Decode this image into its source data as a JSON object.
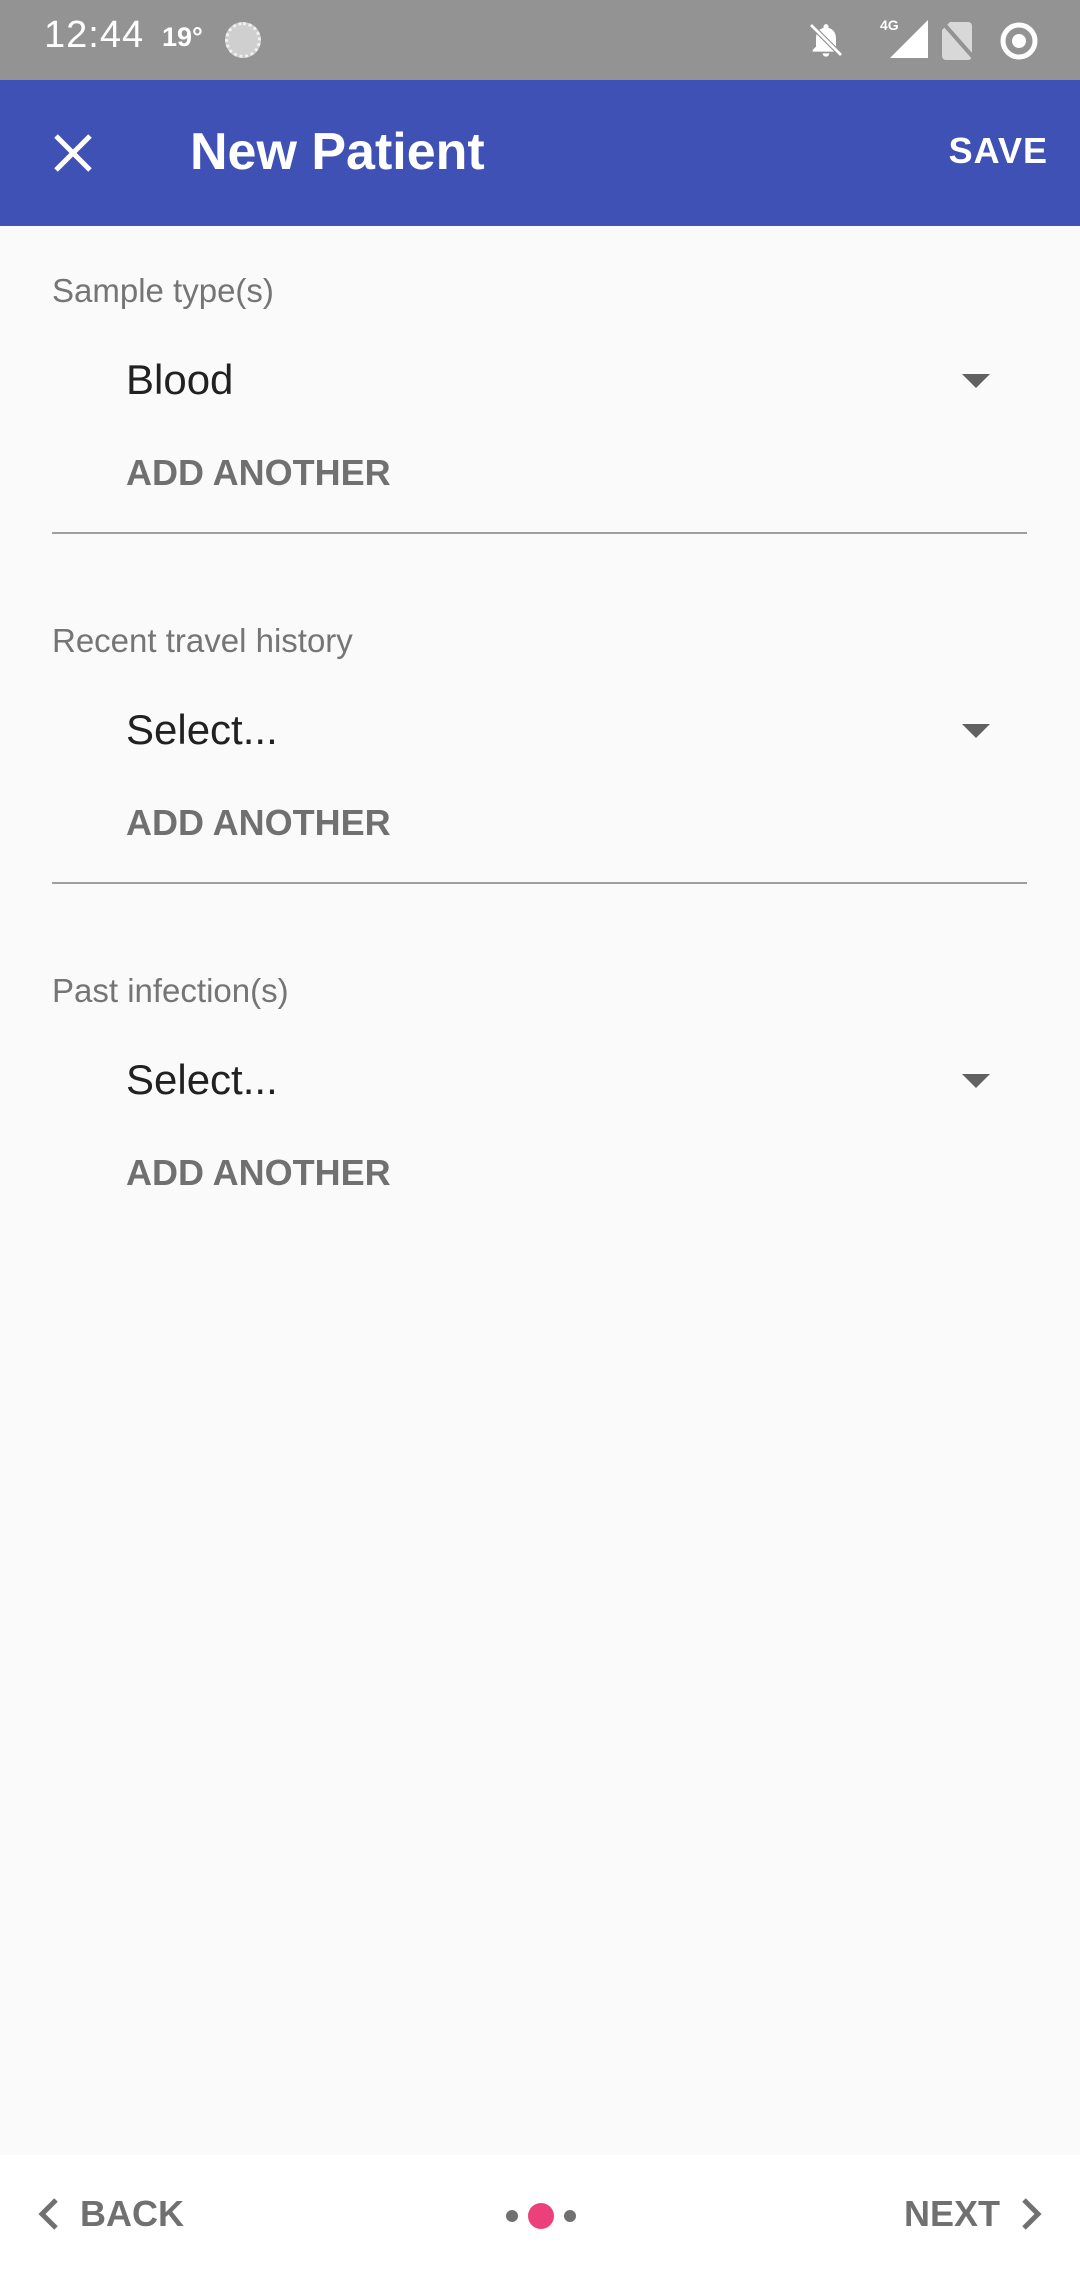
{
  "status_bar": {
    "time": "12:44",
    "temperature": "19°",
    "network": "4G"
  },
  "app_bar": {
    "title": "New Patient",
    "save_label": "SAVE",
    "color": "#3f51b5"
  },
  "form": {
    "sections": [
      {
        "label": "Sample type(s)",
        "value": "Blood",
        "add_label": "ADD ANOTHER"
      },
      {
        "label": "Recent travel history",
        "value": "Select...",
        "add_label": "ADD ANOTHER"
      },
      {
        "label": "Past infection(s)",
        "value": "Select...",
        "add_label": "ADD ANOTHER"
      }
    ]
  },
  "bottom_nav": {
    "back_label": "BACK",
    "next_label": "NEXT",
    "page_total": 3,
    "page_current": 2,
    "accent": "#ec407a"
  }
}
